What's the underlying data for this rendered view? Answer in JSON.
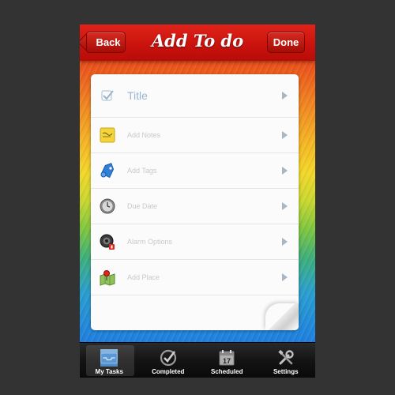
{
  "navbar": {
    "back_label": "Back",
    "title": "Add To do",
    "done_label": "Done"
  },
  "rows": [
    {
      "label": "Title",
      "icon": "checkmark-icon"
    },
    {
      "label": "Add Notes",
      "icon": "notes-icon"
    },
    {
      "label": "Add Tags",
      "icon": "tag-icon"
    },
    {
      "label": "Due Date",
      "icon": "clock-icon"
    },
    {
      "label": "Alarm Options",
      "icon": "alarm-speaker-icon"
    },
    {
      "label": "Add Place",
      "icon": "map-pin-icon"
    }
  ],
  "tabbar": {
    "tabs": [
      {
        "label": "My Tasks",
        "icon": "inbox-tray-icon"
      },
      {
        "label": "Completed",
        "icon": "check-circle-icon"
      },
      {
        "label": "Scheduled",
        "icon": "calendar-icon",
        "day": "17"
      },
      {
        "label": "Settings",
        "icon": "tools-icon"
      }
    ]
  }
}
